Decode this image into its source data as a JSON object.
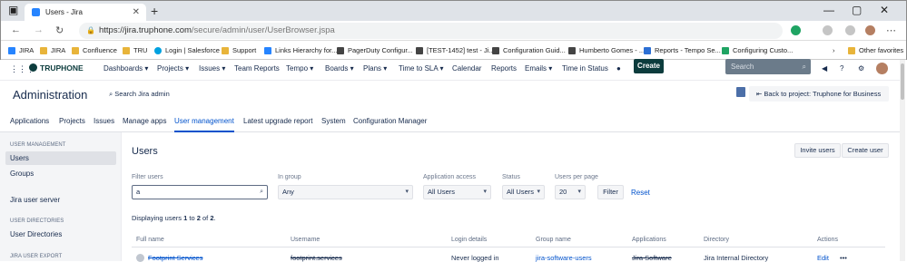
{
  "browser": {
    "tab_title": "Users - Jira",
    "url_host": "https://jira.truphone.com",
    "url_path": "/secure/admin/user/UserBrowser.jspa",
    "bookmarks": [
      "JIRA",
      "JIRA",
      "Confluence",
      "TRU",
      "Login | Salesforce",
      "Support",
      "Links Hierarchy for...",
      "PagerDuty Configur...",
      "[TEST-1452] test - Ji...",
      "Configuration Guid...",
      "Humberto Gomes - ...",
      "Reports - Tempo Se...",
      "Configuring Custo..."
    ],
    "other_favorites": "Other favorites"
  },
  "jira": {
    "logo": "TRUPHONE",
    "nav": [
      "Dashboards ▾",
      "Projects ▾",
      "Issues ▾",
      "Team Reports",
      "Tempo ▾",
      "Boards ▾",
      "Plans ▾",
      "Time to SLA ▾",
      "Calendar",
      "Reports",
      "Emails ▾",
      "Time in Status"
    ],
    "create": "Create",
    "search_placeholder": "Search"
  },
  "admin": {
    "title": "Administration",
    "search": "Search Jira admin",
    "back": "Back to project: Truphone for Business",
    "tabs": [
      "Applications",
      "Projects",
      "Issues",
      "Manage apps",
      "User management",
      "Latest upgrade report",
      "System",
      "Configuration Manager"
    ]
  },
  "sidebar": {
    "h1": "USER MANAGEMENT",
    "users": "Users",
    "groups": "Groups",
    "server": "Jira user server",
    "h2": "USER DIRECTORIES",
    "dirs": "User Directories",
    "h3": "JIRA USER EXPORT"
  },
  "users": {
    "title": "Users",
    "invite": "Invite users",
    "create": "Create user",
    "filter_label": "Filter users",
    "filter_value": "a",
    "group_label": "In group",
    "group_value": "Any",
    "app_label": "Application access",
    "app_value": "All Users",
    "status_label": "Status",
    "status_value": "All Users",
    "perpage_label": "Users per page",
    "perpage_value": "20",
    "filter_btn": "Filter",
    "reset": "Reset",
    "display_pre": "Displaying users ",
    "display_from": "1",
    "display_to_word": " to ",
    "display_to": "2",
    "display_of": " of ",
    "display_total": "2",
    "display_end": ".",
    "columns": [
      "Full name",
      "Username",
      "Login details",
      "Group name",
      "Applications",
      "Directory",
      "Actions"
    ],
    "row": {
      "full_name": "Footprint Services",
      "username": "footprint.services",
      "login": "Never logged in",
      "group": "jira-software-users",
      "app": "Jira Software",
      "directory": "Jira Internal Directory",
      "action": "Edit",
      "more": "•••"
    }
  }
}
